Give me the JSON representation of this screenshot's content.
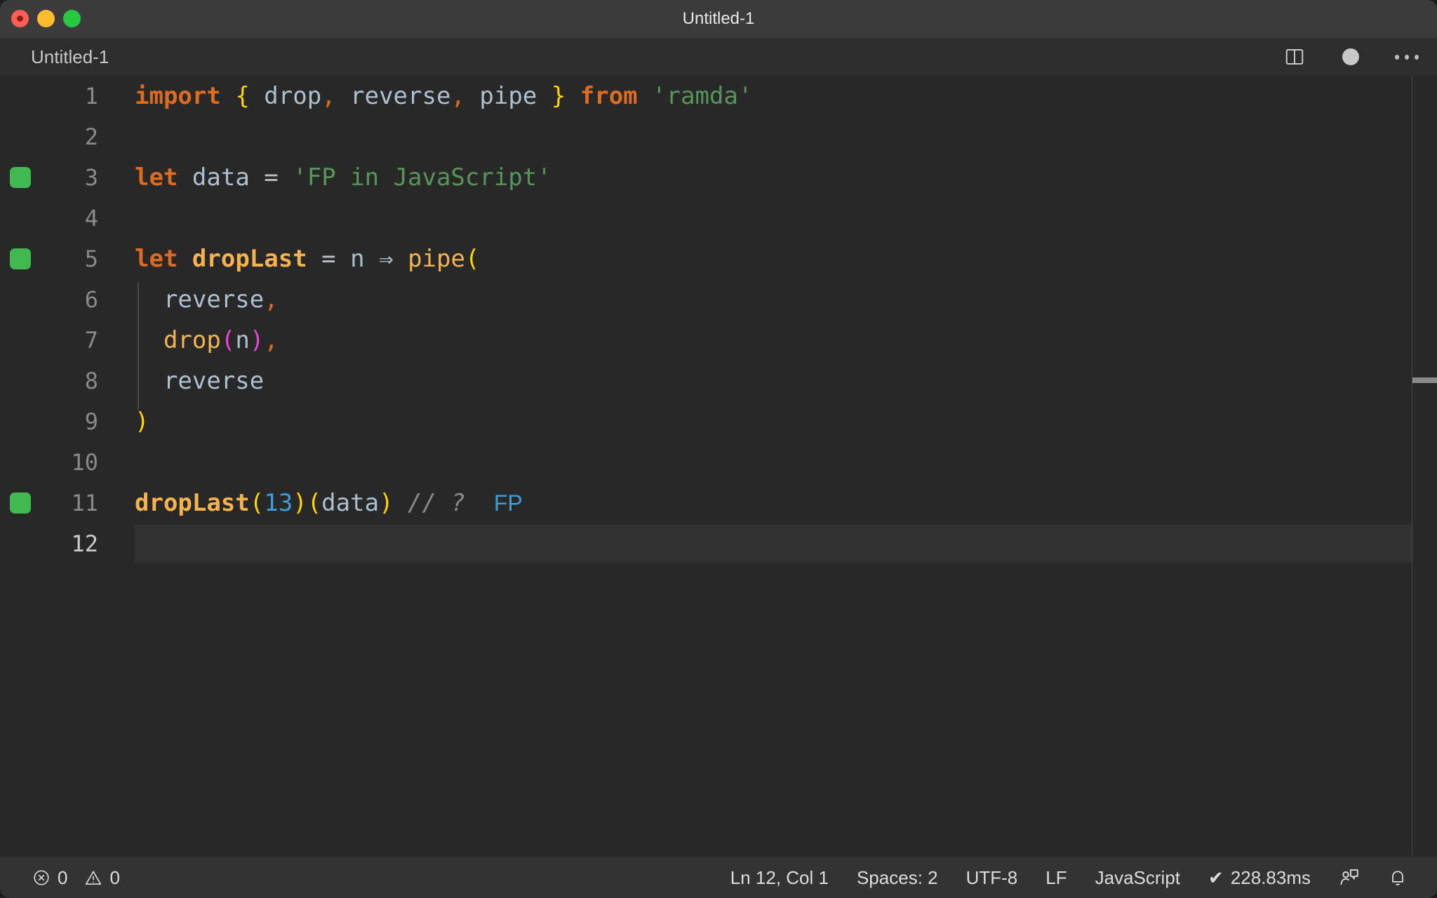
{
  "window": {
    "title": "Untitled-1",
    "traffic_lights": [
      "close-button",
      "minimize-button",
      "zoom-button"
    ]
  },
  "tab": {
    "label": "Untitled-1",
    "split_editor_icon": "split-editor-icon",
    "dirty_icon": "unsaved-dot-icon",
    "more_actions_icon": "more-actions-icon"
  },
  "editor": {
    "language": "JavaScript",
    "lines": [
      {
        "n": "1",
        "marker": false,
        "indent": false,
        "active": false,
        "tokens": [
          {
            "t": "import",
            "c": "t-kw"
          },
          {
            "t": " ",
            "c": "t-op"
          },
          {
            "t": "{",
            "c": "t-brace-y"
          },
          {
            "t": " ",
            "c": "t-op"
          },
          {
            "t": "drop",
            "c": "t-var"
          },
          {
            "t": ",",
            "c": "t-punct"
          },
          {
            "t": " ",
            "c": "t-op"
          },
          {
            "t": "reverse",
            "c": "t-var"
          },
          {
            "t": ",",
            "c": "t-punct"
          },
          {
            "t": " ",
            "c": "t-op"
          },
          {
            "t": "pipe",
            "c": "t-var"
          },
          {
            "t": " ",
            "c": "t-op"
          },
          {
            "t": "}",
            "c": "t-brace-y"
          },
          {
            "t": " ",
            "c": "t-op"
          },
          {
            "t": "from",
            "c": "t-kw"
          },
          {
            "t": " ",
            "c": "t-op"
          },
          {
            "t": "'ramda'",
            "c": "t-str"
          }
        ]
      },
      {
        "n": "2",
        "marker": false,
        "indent": false,
        "active": false,
        "tokens": []
      },
      {
        "n": "3",
        "marker": true,
        "indent": false,
        "active": false,
        "tokens": [
          {
            "t": "let",
            "c": "t-kw"
          },
          {
            "t": " ",
            "c": "t-op"
          },
          {
            "t": "data",
            "c": "t-var"
          },
          {
            "t": " ",
            "c": "t-op"
          },
          {
            "t": "=",
            "c": "t-op"
          },
          {
            "t": " ",
            "c": "t-op"
          },
          {
            "t": "'FP in JavaScript'",
            "c": "t-str"
          }
        ]
      },
      {
        "n": "4",
        "marker": false,
        "indent": false,
        "active": false,
        "tokens": []
      },
      {
        "n": "5",
        "marker": true,
        "indent": false,
        "active": false,
        "tokens": [
          {
            "t": "let",
            "c": "t-kw"
          },
          {
            "t": " ",
            "c": "t-op"
          },
          {
            "t": "dropLast",
            "c": "t-fn"
          },
          {
            "t": " ",
            "c": "t-op"
          },
          {
            "t": "=",
            "c": "t-op"
          },
          {
            "t": " ",
            "c": "t-op"
          },
          {
            "t": "n",
            "c": "t-var"
          },
          {
            "t": " ",
            "c": "t-op"
          },
          {
            "t": "⇒",
            "c": "t-var"
          },
          {
            "t": " ",
            "c": "t-op"
          },
          {
            "t": "pipe",
            "c": "t-fn2"
          },
          {
            "t": "(",
            "c": "t-brace-y"
          }
        ]
      },
      {
        "n": "6",
        "marker": false,
        "indent": true,
        "active": false,
        "tokens": [
          {
            "t": "  ",
            "c": "t-op"
          },
          {
            "t": "reverse",
            "c": "t-var"
          },
          {
            "t": ",",
            "c": "t-punct"
          }
        ]
      },
      {
        "n": "7",
        "marker": false,
        "indent": true,
        "active": false,
        "tokens": [
          {
            "t": "  ",
            "c": "t-op"
          },
          {
            "t": "drop",
            "c": "t-fn2"
          },
          {
            "t": "(",
            "c": "t-brace-m"
          },
          {
            "t": "n",
            "c": "t-var"
          },
          {
            "t": ")",
            "c": "t-brace-m"
          },
          {
            "t": ",",
            "c": "t-punct"
          }
        ]
      },
      {
        "n": "8",
        "marker": false,
        "indent": true,
        "active": false,
        "tokens": [
          {
            "t": "  ",
            "c": "t-op"
          },
          {
            "t": "reverse",
            "c": "t-var"
          }
        ]
      },
      {
        "n": "9",
        "marker": false,
        "indent": false,
        "active": false,
        "tokens": [
          {
            "t": ")",
            "c": "t-brace-y"
          }
        ]
      },
      {
        "n": "10",
        "marker": false,
        "indent": false,
        "active": false,
        "tokens": []
      },
      {
        "n": "11",
        "marker": true,
        "indent": false,
        "active": false,
        "tokens": [
          {
            "t": "dropLast",
            "c": "t-fn"
          },
          {
            "t": "(",
            "c": "t-brace-y"
          },
          {
            "t": "13",
            "c": "t-num"
          },
          {
            "t": ")",
            "c": "t-brace-y"
          },
          {
            "t": "(",
            "c": "t-brace-y"
          },
          {
            "t": "data",
            "c": "t-var"
          },
          {
            "t": ")",
            "c": "t-brace-y"
          },
          {
            "t": " ",
            "c": "t-op"
          },
          {
            "t": "// ?",
            "c": "t-comment"
          },
          {
            "t": "  ",
            "c": "t-op"
          },
          {
            "t": "FP",
            "c": "quokka-out"
          }
        ]
      },
      {
        "n": "12",
        "marker": false,
        "indent": false,
        "active": true,
        "tokens": []
      }
    ]
  },
  "statusbar": {
    "errors_icon": "error-circle-icon",
    "errors_count": "0",
    "warnings_icon": "warning-triangle-icon",
    "warnings_count": "0",
    "cursor_position": "Ln 12, Col 1",
    "indentation": "Spaces: 2",
    "encoding": "UTF-8",
    "eol": "LF",
    "language_mode": "JavaScript",
    "quokka_check": "✔",
    "quokka_time": "228.83ms",
    "feedback_icon": "feedback-smiley-icon",
    "notifications_icon": "bell-icon"
  },
  "colors": {
    "background": "#282828",
    "titlebar": "#3b3b3b",
    "statusbar": "#333333",
    "keyword": "#dd6b20",
    "string": "#57955b",
    "function": "#f5b350",
    "variable": "#aebfd0",
    "number": "#3d9cdb",
    "bracket_yellow": "#ffd500",
    "bracket_magenta": "#e945d8",
    "comment": "#8a8a8a",
    "coverage_marker": "#3fb950"
  }
}
